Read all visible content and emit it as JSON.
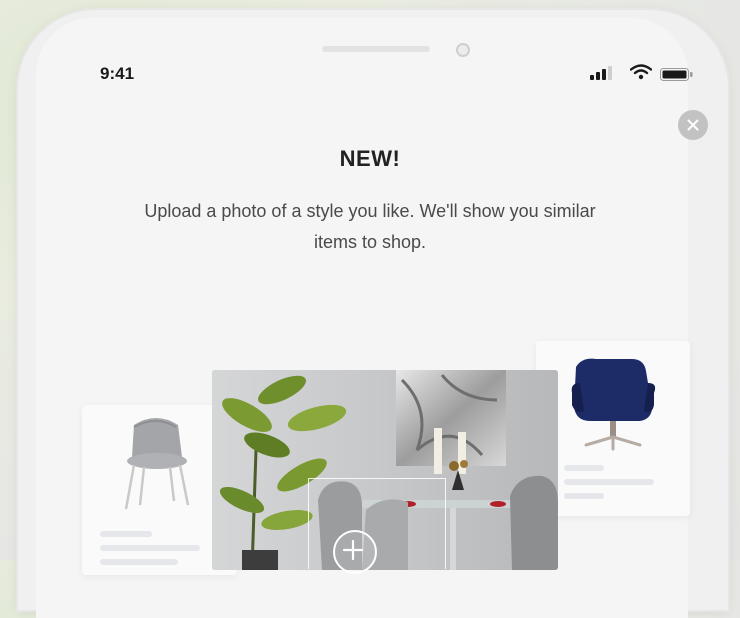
{
  "status_bar": {
    "time": "9:41",
    "signal_icon": "signal-icon",
    "wifi_icon": "wifi-icon",
    "battery_icon": "battery-icon"
  },
  "modal": {
    "close_icon": "close-icon",
    "title": "NEW!",
    "description": "Upload a photo of a style you like. We'll show you similar items to shop."
  },
  "illustration": {
    "left_card_image": "grey-chair-image",
    "right_card_image": "navy-armchair-image",
    "center_photo": "dining-room-photo",
    "add_icon": "plus-icon"
  }
}
